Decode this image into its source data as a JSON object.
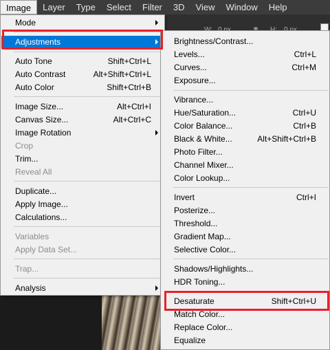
{
  "menubar": {
    "items": [
      "Image",
      "Layer",
      "Type",
      "Select",
      "Filter",
      "3D",
      "View",
      "Window",
      "Help"
    ]
  },
  "options": {
    "w_label": "W:",
    "w_value": "0 px",
    "h_label": "H:",
    "h_value": "0 px",
    "link_icon": "chain-link-icon"
  },
  "image_menu": {
    "mode": "Mode",
    "adjustments": "Adjustments",
    "auto_tone": {
      "label": "Auto Tone",
      "shortcut": "Shift+Ctrl+L"
    },
    "auto_contrast": {
      "label": "Auto Contrast",
      "shortcut": "Alt+Shift+Ctrl+L"
    },
    "auto_color": {
      "label": "Auto Color",
      "shortcut": "Shift+Ctrl+B"
    },
    "image_size": {
      "label": "Image Size...",
      "shortcut": "Alt+Ctrl+I"
    },
    "canvas_size": {
      "label": "Canvas Size...",
      "shortcut": "Alt+Ctrl+C"
    },
    "image_rotation": "Image Rotation",
    "crop": "Crop",
    "trim": "Trim...",
    "reveal_all": "Reveal All",
    "duplicate": "Duplicate...",
    "apply_image": "Apply Image...",
    "calculations": "Calculations...",
    "variables": "Variables",
    "apply_data_set": "Apply Data Set...",
    "trap": "Trap...",
    "analysis": "Analysis"
  },
  "adjustments_menu": {
    "brightness_contrast": {
      "label": "Brightness/Contrast...",
      "shortcut": ""
    },
    "levels": {
      "label": "Levels...",
      "shortcut": "Ctrl+L"
    },
    "curves": {
      "label": "Curves...",
      "shortcut": "Ctrl+M"
    },
    "exposure": {
      "label": "Exposure...",
      "shortcut": ""
    },
    "vibrance": {
      "label": "Vibrance...",
      "shortcut": ""
    },
    "hue_saturation": {
      "label": "Hue/Saturation...",
      "shortcut": "Ctrl+U"
    },
    "color_balance": {
      "label": "Color Balance...",
      "shortcut": "Ctrl+B"
    },
    "black_white": {
      "label": "Black & White...",
      "shortcut": "Alt+Shift+Ctrl+B"
    },
    "photo_filter": {
      "label": "Photo Filter...",
      "shortcut": ""
    },
    "channel_mixer": {
      "label": "Channel Mixer...",
      "shortcut": ""
    },
    "color_lookup": {
      "label": "Color Lookup...",
      "shortcut": ""
    },
    "invert": {
      "label": "Invert",
      "shortcut": "Ctrl+I"
    },
    "posterize": {
      "label": "Posterize...",
      "shortcut": ""
    },
    "threshold": {
      "label": "Threshold...",
      "shortcut": ""
    },
    "gradient_map": {
      "label": "Gradient Map...",
      "shortcut": ""
    },
    "selective_color": {
      "label": "Selective Color...",
      "shortcut": ""
    },
    "shadows_highlights": {
      "label": "Shadows/Highlights...",
      "shortcut": ""
    },
    "hdr_toning": {
      "label": "HDR Toning...",
      "shortcut": ""
    },
    "desaturate": {
      "label": "Desaturate",
      "shortcut": "Shift+Ctrl+U"
    },
    "match_color": {
      "label": "Match Color...",
      "shortcut": ""
    },
    "replace_color": {
      "label": "Replace Color...",
      "shortcut": ""
    },
    "equalize": {
      "label": "Equalize",
      "shortcut": ""
    }
  },
  "colors": {
    "highlight": "#0078d7",
    "annotation_red": "#e8202a",
    "menu_bg": "#f0f0f0",
    "disabled_text": "#8c8c8c"
  }
}
